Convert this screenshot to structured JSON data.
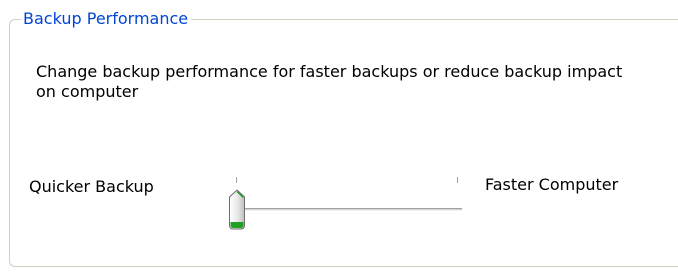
{
  "group": {
    "title": "Backup Performance",
    "description": "Change backup performance for faster backups or reduce backup impact on computer"
  },
  "slider": {
    "left_label": "Quicker Backup",
    "right_label": "Faster Computer",
    "position": 0,
    "min_tick": 0,
    "max_tick": 1
  },
  "colors": {
    "title": "#0046d5",
    "groupbox_border": "#d0d0bf",
    "thumb_fill": "#e4e4e4",
    "thumb_accent": "#21a121"
  }
}
